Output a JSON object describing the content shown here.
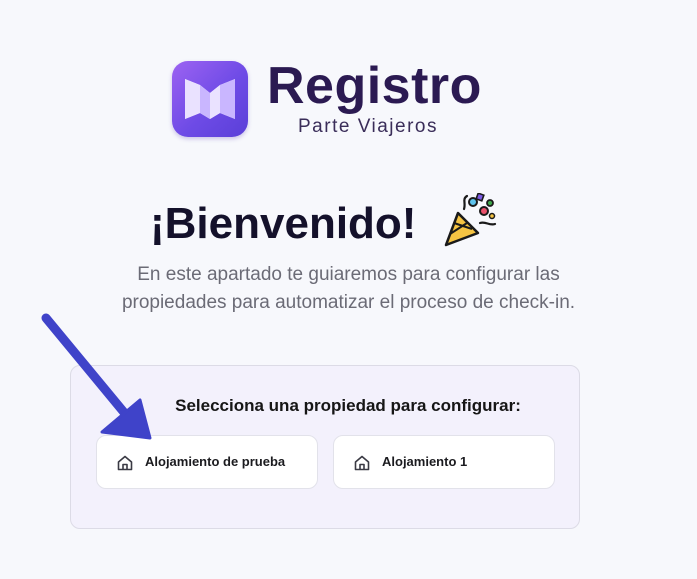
{
  "brand": {
    "title": "Registro",
    "subtitle": "Parte Viajeros",
    "logo_icon": "registro-logo-icon",
    "colors": {
      "logo_gradient_start": "#9d63f2",
      "logo_gradient_end": "#5a3fd8",
      "title": "#2b1a52"
    }
  },
  "welcome": {
    "heading": "¡Bienvenido!",
    "icon": "party-popper-icon",
    "intro_line_1": "En este apartado te guiaremos para configurar las",
    "intro_line_2": "propiedades para automatizar el proceso de check-in."
  },
  "properties_panel": {
    "title": "Selecciona una propiedad para configurar:",
    "items": [
      {
        "label": "Alojamiento de prueba",
        "icon": "home-icon"
      },
      {
        "label": "Alojamiento 1",
        "icon": "home-icon"
      }
    ]
  },
  "annotation": {
    "icon": "arrow-annotation-icon",
    "color": "#3f43c9"
  }
}
